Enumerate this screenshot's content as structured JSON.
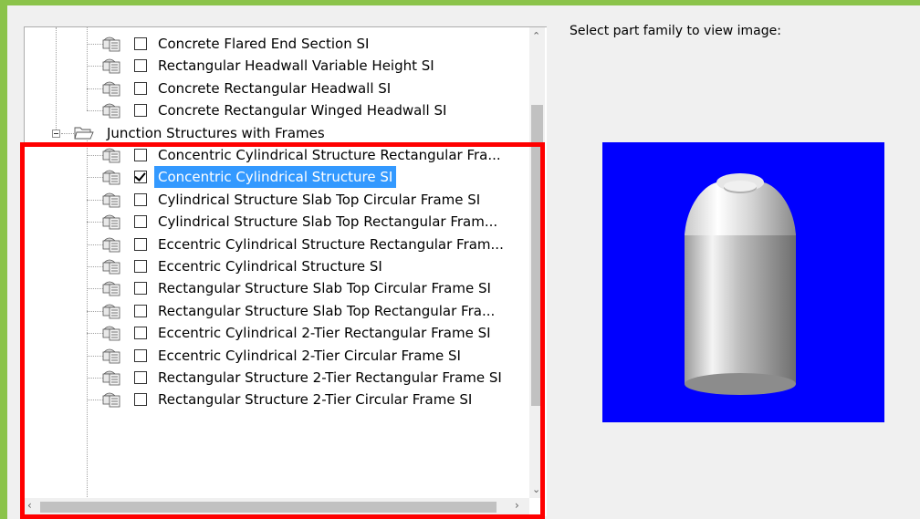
{
  "tree": {
    "items": [
      {
        "label": "Concrete Flared End Section SI",
        "checked": false
      },
      {
        "label": "Rectangular Headwall Variable Height SI",
        "checked": false
      },
      {
        "label": "Concrete Rectangular Headwall SI",
        "checked": false
      },
      {
        "label": "Concrete Rectangular Winged Headwall SI",
        "checked": false
      }
    ],
    "group": {
      "label": "Junction Structures with Frames",
      "items": [
        {
          "label": "Concentric Cylindrical Structure Rectangular Fra...",
          "checked": false
        },
        {
          "label": "Concentric Cylindrical Structure SI",
          "checked": true,
          "selected": true
        },
        {
          "label": "Cylindrical Structure Slab Top Circular Frame SI",
          "checked": false
        },
        {
          "label": "Cylindrical Structure Slab Top Rectangular Fram...",
          "checked": false
        },
        {
          "label": "Eccentric Cylindrical Structure Rectangular Fram...",
          "checked": false
        },
        {
          "label": "Eccentric Cylindrical Structure SI",
          "checked": false
        },
        {
          "label": "Rectangular Structure Slab Top Circular Frame SI",
          "checked": false
        },
        {
          "label": "Rectangular Structure Slab Top Rectangular Fra...",
          "checked": false
        },
        {
          "label": "Eccentric Cylindrical 2-Tier Rectangular Frame SI",
          "checked": false
        },
        {
          "label": "Eccentric Cylindrical 2-Tier Circular Frame SI",
          "checked": false
        },
        {
          "label": "Rectangular Structure 2-Tier Rectangular Frame SI",
          "checked": false
        },
        {
          "label": "Rectangular Structure 2-Tier Circular Frame SI",
          "checked": false
        }
      ]
    }
  },
  "preview": {
    "prompt": "Select part family to view image:",
    "background": "#0000ff"
  },
  "colors": {
    "selection": "#3399ff",
    "highlight_border": "#ff0000",
    "accent_green": "#8bc34a"
  },
  "icons": {
    "part": "part-family-icon",
    "folder": "open-folder-icon",
    "up": "scroll-up-arrow-icon",
    "down": "scroll-down-arrow-icon",
    "left": "scroll-left-arrow-icon",
    "right": "scroll-right-arrow-icon"
  }
}
